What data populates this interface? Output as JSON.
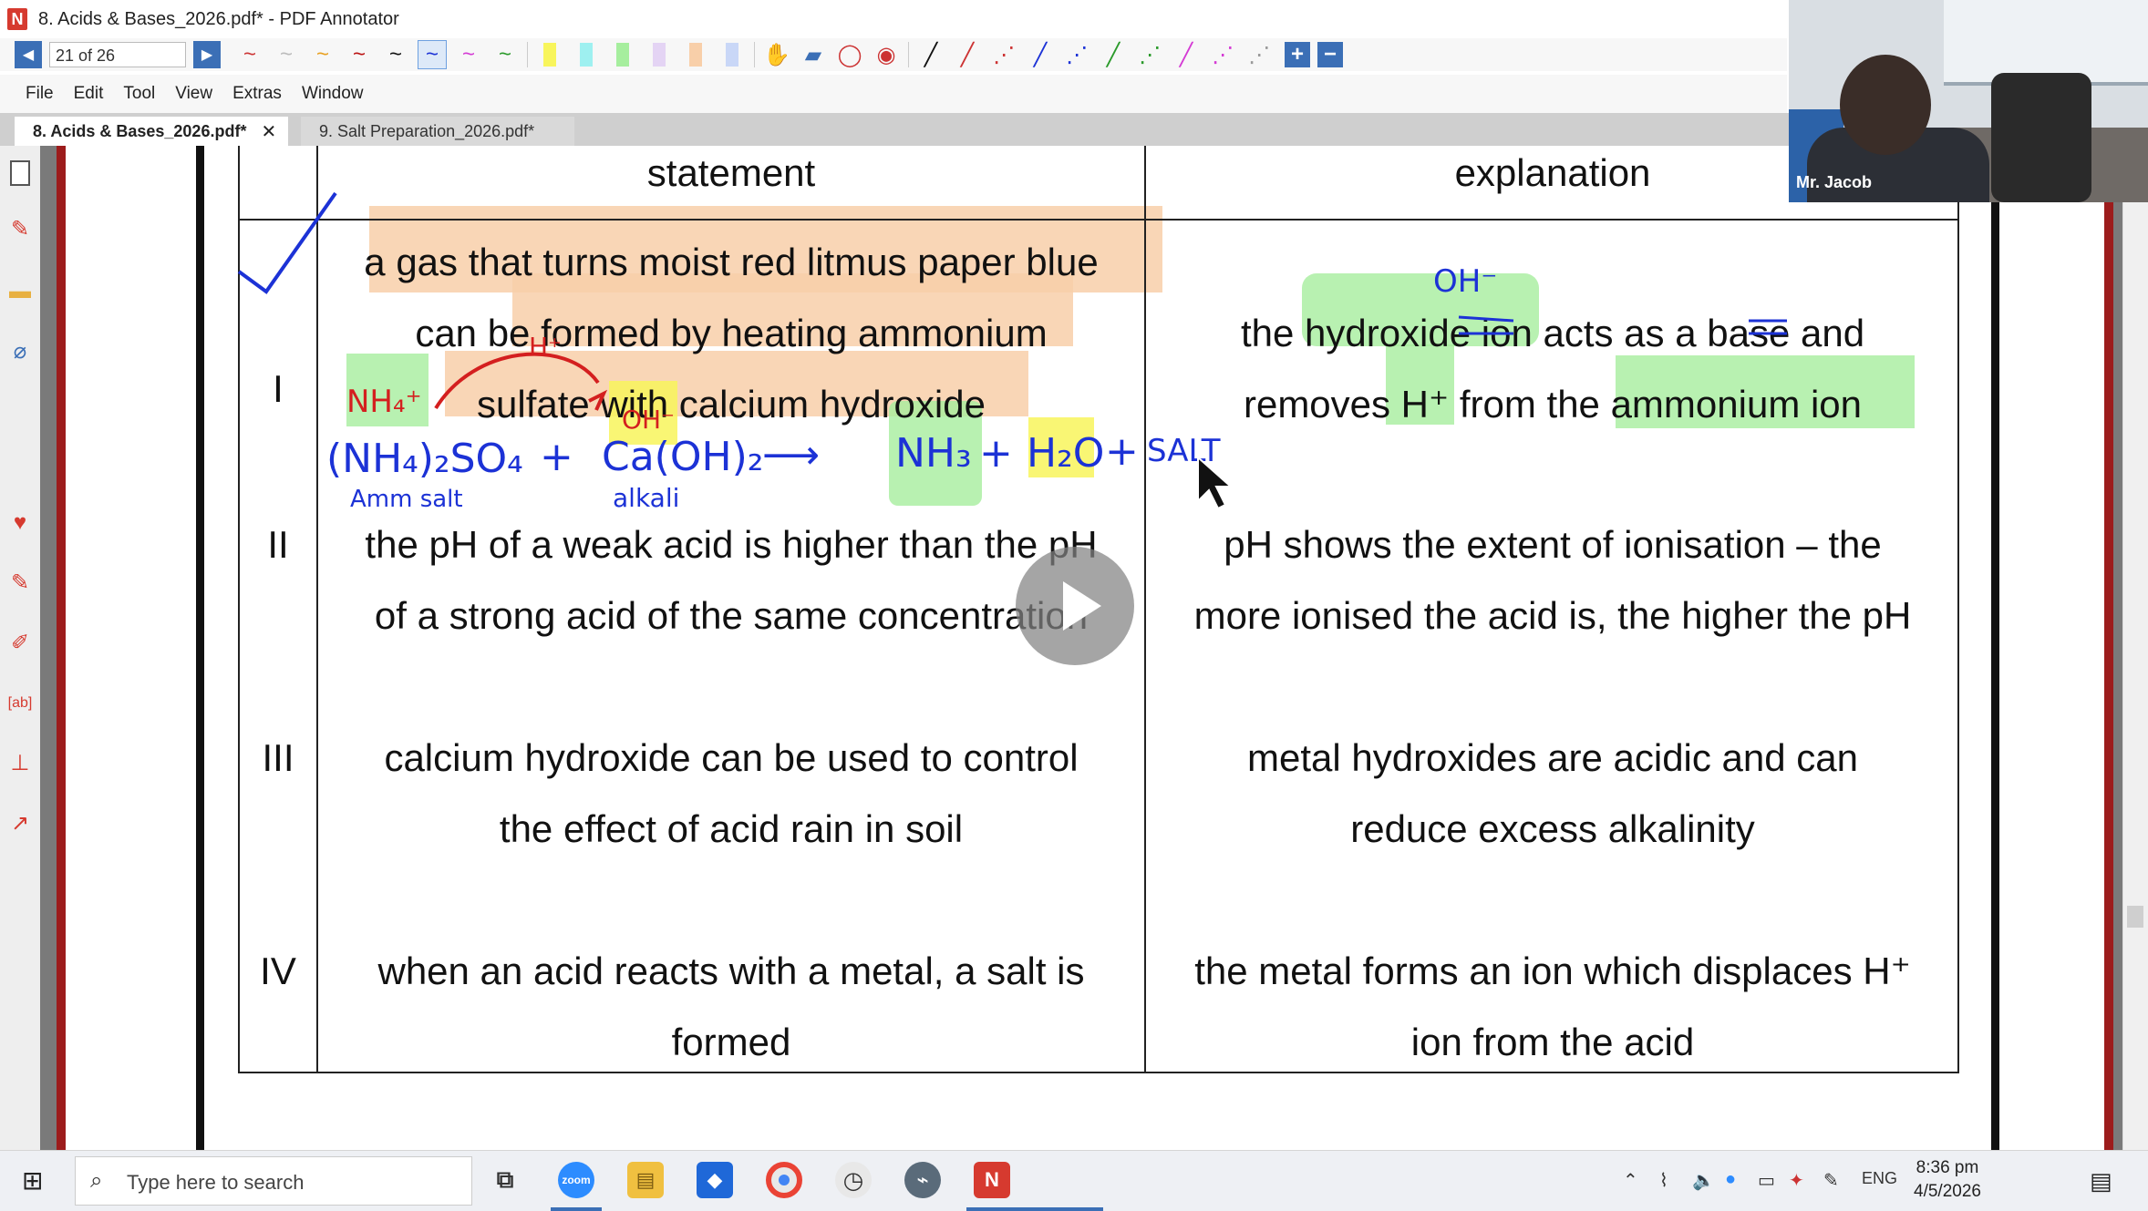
{
  "window": {
    "title": "8. Acids & Bases_2026.pdf* - PDF Annotator"
  },
  "toolbar": {
    "page_indicator": "21 of 26"
  },
  "menu": [
    "File",
    "Edit",
    "Tool",
    "View",
    "Extras",
    "Window"
  ],
  "tabs": [
    {
      "label": "8. Acids & Bases_2026.pdf*",
      "active": true,
      "close": "✕"
    },
    {
      "label": "9. Salt Preparation_2026.pdf*",
      "active": false
    }
  ],
  "table": {
    "headers": {
      "statement": "statement",
      "explanation": "explanation"
    },
    "rows": [
      {
        "num": "I",
        "statement_lines": [
          "a gas that turns moist red litmus paper blue",
          "can be formed by heating ammonium",
          "sulfate with calcium hydroxide"
        ],
        "explanation_lines": [
          "the hydroxide ion acts as a base and",
          "removes H⁺ from the ammonium ion"
        ]
      },
      {
        "num": "II",
        "statement_lines": [
          "the pH of a weak acid is higher than the pH",
          "of a strong acid of the same concentration"
        ],
        "explanation_lines": [
          "pH shows the extent of ionisation – the",
          "more ionised the acid is, the higher the pH"
        ]
      },
      {
        "num": "III",
        "statement_lines": [
          "calcium hydroxide can be used to control",
          "the effect of acid rain in soil"
        ],
        "explanation_lines": [
          "metal hydroxides are acidic and can",
          "reduce excess alkalinity"
        ]
      },
      {
        "num": "IV",
        "statement_lines": [
          "when an acid reacts with a metal, a salt is",
          "formed"
        ],
        "explanation_lines": [
          "the metal forms an ion which displaces H⁺",
          "ion from the acid"
        ]
      }
    ]
  },
  "handwriting": {
    "tick": "✓",
    "nh4": "NH₄⁺",
    "h_plus": "H⁺",
    "oh_minus_row": "OH⁻",
    "oh_minus_expl": "OH⁻",
    "equation": {
      "reactant1": "(NH₄)₂SO₄",
      "plus1": "+",
      "reactant2": "Ca(OH)₂",
      "arrow": "⟶",
      "product1": "NH₃",
      "plus2": "+",
      "product2": "H₂O",
      "plus3": "+",
      "product3": "SALT"
    },
    "label_reactant1": "Amm salt",
    "label_reactant2": "alkali"
  },
  "webcam": {
    "name": "Mr. Jacob"
  },
  "taskbar": {
    "search_placeholder": "Type here to search",
    "language": "ENG",
    "time": "8:36 pm",
    "date": "4/5/2026"
  },
  "colors": {
    "ink_blue": "#1c32d6",
    "ink_red": "#d41f1f",
    "highlight_orange": "#f8cfa9",
    "highlight_green": "#a6ee9e",
    "highlight_yellow": "#f8f55c",
    "app_accent": "#3b6fb6"
  }
}
